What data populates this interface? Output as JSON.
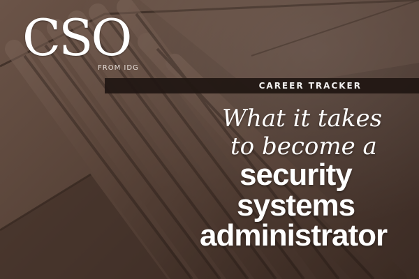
{
  "brand": {
    "logo_text": "CSO",
    "sub_text": "FROM IDG"
  },
  "band": {
    "label": "CAREER TRACKER"
  },
  "headline": {
    "line1": "What it takes",
    "line2": "to become a",
    "line3": "security",
    "line4": "systems",
    "line5": "administrator"
  },
  "colors": {
    "text": "#ffffff",
    "band": "#201612",
    "background": "#5a453a"
  }
}
